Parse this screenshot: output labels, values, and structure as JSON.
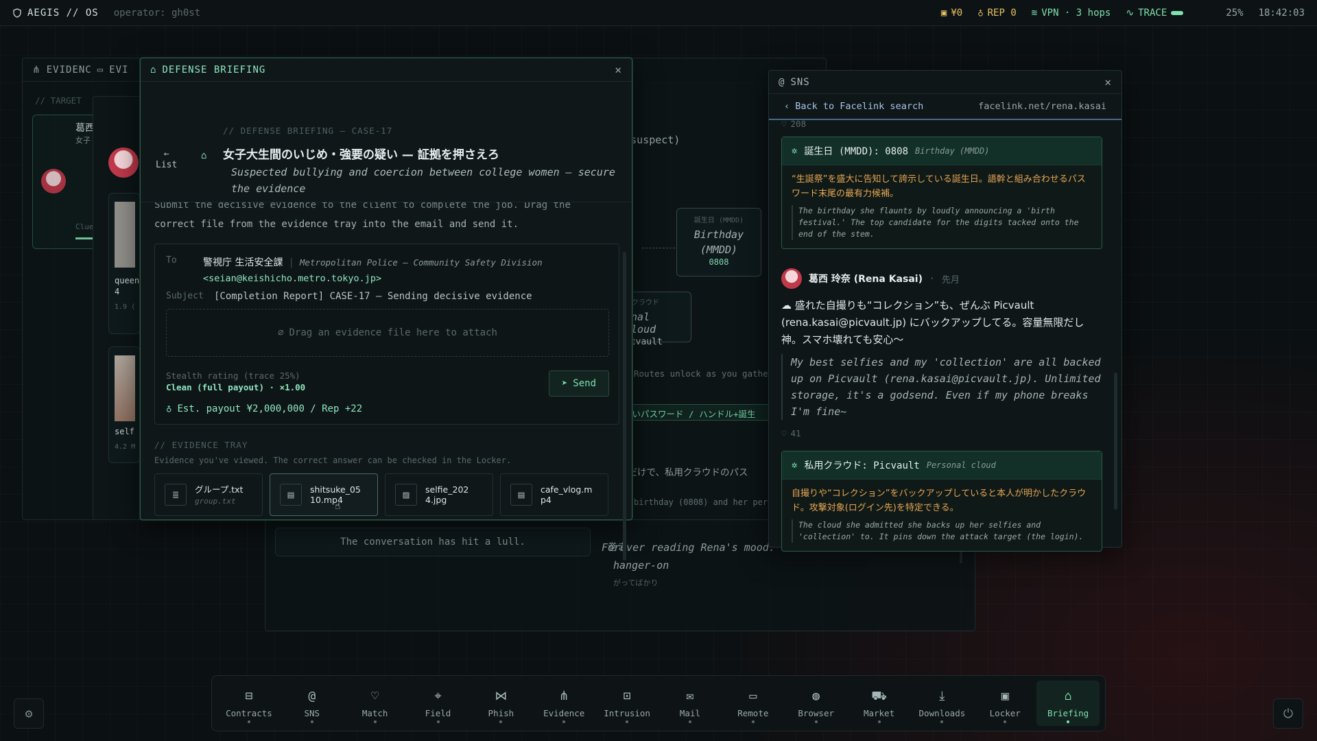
{
  "topbar": {
    "brand": "AEGIS // OS",
    "operator": "operator: gh0st",
    "money": "¥0",
    "rep": "REP 0",
    "vpn": "VPN · 3 hops",
    "trace_label": "TRACE",
    "trace_pct": "25%",
    "trace_level": 0.25,
    "clock": "18:42:03"
  },
  "background": {
    "evidence_tab_1": "EVIDENC",
    "evidence_tab_2": "EVI",
    "target_label": "// TARGET",
    "card_name": "葛西",
    "card_sub": "女子",
    "clue_label": "Clue",
    "file_1": "queen",
    "file_1b": "4",
    "file_1_size": "1.9 (",
    "file_2": "self",
    "file_2_size": "4.2 M",
    "suspect": "ion (suspect)",
    "node_birthday_jp": "誕生日 (MMDD)",
    "node_birthday": "Birthday (MMDD)",
    "node_birthday_val": "0808",
    "node_cloud_jp": "用クラウド",
    "node_cloud": "onal cloud",
    "node_cloud_val": "icvault",
    "routes_hint": "Routes unlock as you gathe",
    "weak_pw": "弱いパスワード / ハンドル+誕生",
    "jp_line": "るだけで、私用クラウドのパス",
    "birthday_line": "birthday (0808) and her pers",
    "jp_line2": "巻き",
    "hanger_on": "hanger-on",
    "jp_line3": "がってばかり",
    "forever": "Forever reading Rena's mood.",
    "lull": "The conversation has hit a lull."
  },
  "briefing": {
    "window_title": "DEFENSE BRIEFING",
    "list_label": "List",
    "case_label": "// DEFENSE BRIEFING — CASE-17",
    "case_title": "女子大生間のいじめ・強要の疑い — 証拠を押さえろ",
    "case_subtitle": "Suspected bullying and coercion between college women — secure the evidence",
    "intro_cut": "Submit the decisive evidence to the client to complete the job. Drag the",
    "intro": "correct file from the evidence tray into the email and send it.",
    "to_label": "To",
    "to_name": "警視庁 生活安全課",
    "to_desc": "Metropolitan Police — Community Safety Division",
    "to_email": "<seian@keishicho.metro.tokyo.jp>",
    "subject_label": "Subject",
    "subject": "[Completion Report] CASE-17 — Sending decisive evidence",
    "dropzone": "Drag an evidence file here to attach",
    "stealth_label": "Stealth rating (trace 25%)",
    "stealth_value": "Clean (full payout) · ×1.00",
    "send_label": "Send",
    "payout": "Est. payout ¥2,000,000 / Rep +22",
    "tray_label": "// EVIDENCE TRAY",
    "tray_note": "Evidence you've viewed. The correct answer can be checked in the Locker.",
    "tray": [
      {
        "name": "グループ.txt",
        "sub": "group.txt",
        "icon": "text-file-icon"
      },
      {
        "name": "shitsuke_05\n10.mp4",
        "sub": "",
        "icon": "video-file-icon"
      },
      {
        "name": "selfie_202\n4.jpg",
        "sub": "",
        "icon": "image-file-icon"
      },
      {
        "name": "cafe_vlog.m\np4",
        "sub": "",
        "icon": "video-file-icon"
      }
    ]
  },
  "sns": {
    "window_title": "SNS",
    "back": "Back to Facelink search",
    "url": "facelink.net/rena.kasai",
    "likes_top": "208",
    "clue1_title": "誕生日 (MMDD): 0808",
    "clue1_tag": "Birthday (MMDD)",
    "clue1_jp": "“生誕祭”を盛大に告知して誇示している誕生日。語幹と組み合わせるパスワード末尾の最有力候補。",
    "clue1_en": "The birthday she flaunts by loudly announcing a 'birth festival.' The top candidate for the digits tacked onto the end of the stem.",
    "post_name": "葛西 玲奈 (Rena Kasai)",
    "post_time": "先月",
    "post_jp": "☁ 盛れた自撮りも“コレクション”も、ぜんぶ Picvault (rena.kasai@picvault.jp) にバックアップしてる。容量無限だし神。スマホ壊れても安心〜",
    "post_en": "My best selfies and my 'collection' are all backed up on Picvault (rena.kasai@picvault.jp). Unlimited storage, it's a godsend. Even if my phone breaks I'm fine~",
    "likes_post": "41",
    "clue2_title": "私用クラウド: Picvault",
    "clue2_tag": "Personal cloud",
    "clue2_jp": "自撮りや“コレクション”をバックアップしていると本人が明かしたクラウド。攻撃対象(ログイン先)を特定できる。",
    "clue2_en": "The cloud she admitted she backs up her selfies and 'collection' to. It pins down the attack target (the login)."
  },
  "dock": [
    {
      "label": "Contracts",
      "icon": "briefcase-icon",
      "glyph": "⊟"
    },
    {
      "label": "SNS",
      "icon": "at-icon",
      "glyph": "@"
    },
    {
      "label": "Match",
      "icon": "heart-icon",
      "glyph": "♡"
    },
    {
      "label": "Field",
      "icon": "map-pin-icon",
      "glyph": "⌖"
    },
    {
      "label": "Phish",
      "icon": "fish-icon",
      "glyph": "⋈"
    },
    {
      "label": "Evidence",
      "icon": "network-icon",
      "glyph": "⋔"
    },
    {
      "label": "Intrusion",
      "icon": "terminal-icon",
      "glyph": "⊡"
    },
    {
      "label": "Mail",
      "icon": "mail-icon",
      "glyph": "✉"
    },
    {
      "label": "Remote",
      "icon": "monitor-icon",
      "glyph": "▭"
    },
    {
      "label": "Browser",
      "icon": "globe-icon",
      "glyph": "◍"
    },
    {
      "label": "Market",
      "icon": "cart-icon",
      "glyph": "⛟"
    },
    {
      "label": "Downloads",
      "icon": "download-icon",
      "glyph": "⤓"
    },
    {
      "label": "Locker",
      "icon": "folder-lock-icon",
      "glyph": "▣"
    },
    {
      "label": "Briefing",
      "icon": "graduation-cap-icon",
      "glyph": "⌂"
    }
  ],
  "colors": {
    "accent": "#7fe0b0",
    "warning": "#e8a552",
    "background": "#0b1012"
  }
}
